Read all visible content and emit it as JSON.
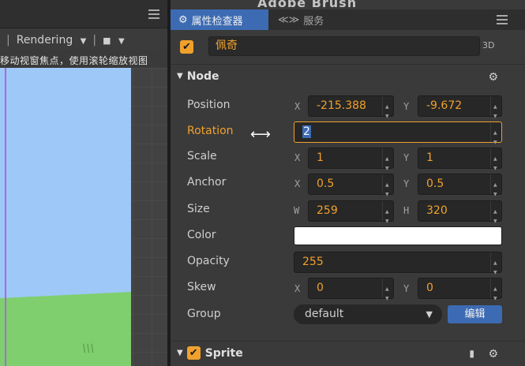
{
  "scene": {
    "toolbar": {
      "sep_left": "|",
      "rendering_label": "Rendering",
      "rendering_arrow": "▼",
      "sep_right": "|",
      "camera_arrow": "▼"
    },
    "hint": "移动视窗焦点，使用滚轮缩放视图",
    "grass_mark": "\\\\\\"
  },
  "watermark": "Adobe Brush",
  "tabs": {
    "inspector_label": "属性检查器",
    "services_label": "服务"
  },
  "node": {
    "enabled": true,
    "name": "佩奇",
    "badge": "3D",
    "section_title": "Node",
    "properties": {
      "position": {
        "label": "Position",
        "x_axis": "X",
        "x": "-215.388",
        "y_axis": "Y",
        "y": "-9.672"
      },
      "rotation": {
        "label": "Rotation",
        "value": "2"
      },
      "scale": {
        "label": "Scale",
        "x_axis": "X",
        "x": "1",
        "y_axis": "Y",
        "y": "1"
      },
      "anchor": {
        "label": "Anchor",
        "x_axis": "X",
        "x": "0.5",
        "y_axis": "Y",
        "y": "0.5"
      },
      "size": {
        "label": "Size",
        "w_axis": "W",
        "w": "259",
        "h_axis": "H",
        "h": "320"
      },
      "color": {
        "label": "Color",
        "value": "#ffffff"
      },
      "opacity": {
        "label": "Opacity",
        "value": "255"
      },
      "skew": {
        "label": "Skew",
        "x_axis": "X",
        "x": "0",
        "y_axis": "Y",
        "y": "0"
      },
      "group": {
        "label": "Group",
        "value": "default",
        "edit_label": "编辑"
      }
    }
  },
  "sprite": {
    "section_title": "Sprite",
    "enabled": true
  },
  "icons": {
    "checkmark": "✔",
    "gear": "⚙",
    "collapse_arrow": "▼",
    "resize_cursor": "⟷",
    "book": "▮",
    "camera": "■",
    "services": "≪≫",
    "inspector": "⚙"
  },
  "colors": {
    "accent": "#f0a12c",
    "tab_active": "#3d6bb3",
    "sky": "#9ec8f7",
    "grass": "#7fcf6e"
  }
}
